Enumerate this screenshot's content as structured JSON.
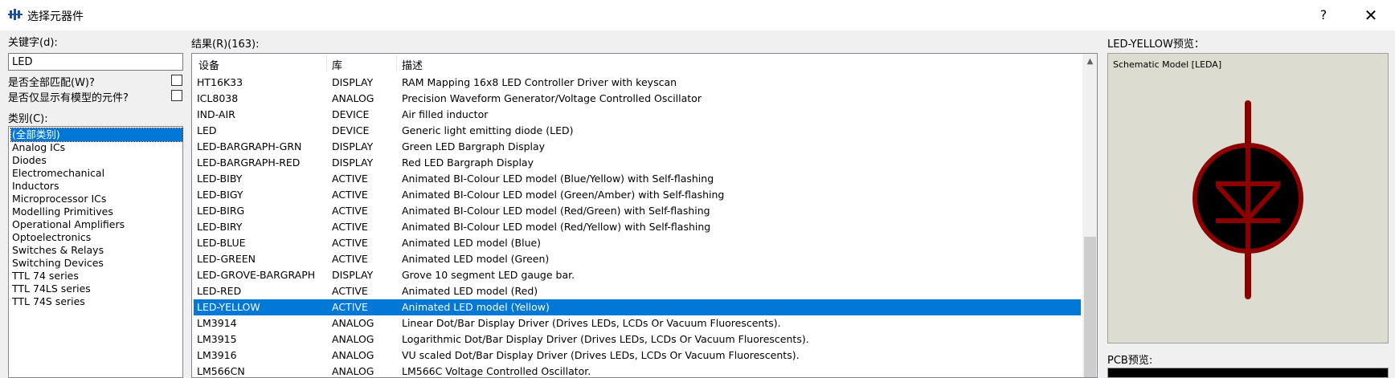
{
  "window": {
    "title": "选择元器件",
    "help": "?",
    "close": "✕"
  },
  "keyword": {
    "label": "关键字(d):",
    "value": "LED"
  },
  "options": [
    {
      "label": "是否全部匹配(W)?",
      "checked": false
    },
    {
      "label": "是否仅显示有模型的元件?",
      "checked": false
    }
  ],
  "categories": {
    "label": "类别(C):",
    "items": [
      "(全部类别)",
      "Analog ICs",
      "Diodes",
      "Electromechanical",
      "Inductors",
      "Microprocessor ICs",
      "Modelling Primitives",
      "Operational Amplifiers",
      "Optoelectronics",
      "Switches & Relays",
      "Switching Devices",
      "TTL 74 series",
      "TTL 74LS series",
      "TTL 74S series"
    ],
    "selected": 0
  },
  "results": {
    "label": "结果(R)(163):",
    "columns": [
      "设备",
      "库",
      "描述"
    ],
    "rows": [
      [
        "HT16K33",
        "DISPLAY",
        "RAM Mapping 16x8 LED Controller Driver with keyscan"
      ],
      [
        "ICL8038",
        "ANALOG",
        "Precision Waveform Generator/Voltage Controlled Oscillator"
      ],
      [
        "IND-AIR",
        "DEVICE",
        "Air filled inductor"
      ],
      [
        "LED",
        "DEVICE",
        "Generic light emitting diode (LED)"
      ],
      [
        "LED-BARGRAPH-GRN",
        "DISPLAY",
        "Green LED Bargraph Display"
      ],
      [
        "LED-BARGRAPH-RED",
        "DISPLAY",
        "Red LED Bargraph Display"
      ],
      [
        "LED-BIBY",
        "ACTIVE",
        "Animated BI-Colour LED model (Blue/Yellow) with Self-flashing"
      ],
      [
        "LED-BIGY",
        "ACTIVE",
        "Animated BI-Colour LED model (Green/Amber) with Self-flashing"
      ],
      [
        "LED-BIRG",
        "ACTIVE",
        "Animated BI-Colour LED model (Red/Green) with Self-flashing"
      ],
      [
        "LED-BIRY",
        "ACTIVE",
        "Animated BI-Colour LED model (Red/Yellow) with Self-flashing"
      ],
      [
        "LED-BLUE",
        "ACTIVE",
        "Animated LED model (Blue)"
      ],
      [
        "LED-GREEN",
        "ACTIVE",
        "Animated LED model (Green)"
      ],
      [
        "LED-GROVE-BARGRAPH",
        "DISPLAY",
        "Grove 10 segment LED gauge bar."
      ],
      [
        "LED-RED",
        "ACTIVE",
        "Animated LED model (Red)"
      ],
      [
        "LED-YELLOW",
        "ACTIVE",
        "Animated LED model (Yellow)"
      ],
      [
        "LM3914",
        "ANALOG",
        "Linear Dot/Bar Display Driver (Drives LEDs, LCDs Or Vacuum Fluorescents)."
      ],
      [
        "LM3915",
        "ANALOG",
        "Logarithmic Dot/Bar Display Driver (Drives LEDs, LCDs Or Vacuum Fluorescents)."
      ],
      [
        "LM3916",
        "ANALOG",
        "VU scaled Dot/Bar Display Driver (Drives LEDs, LCDs Or Vacuum Fluorescents)."
      ],
      [
        "LM566CN",
        "ANALOG",
        "LM566C Voltage Controlled Oscillator."
      ]
    ],
    "selected": 14,
    "scroll_position": 0.56
  },
  "preview": {
    "label": "LED-YELLOW预览：",
    "model": "Schematic Model [LEDA]"
  },
  "pcb": {
    "label": "PCB预览:"
  },
  "colors": {
    "selection": "#0078d7",
    "symbol": "#8b0000",
    "preview_bg": "#dcdcd0"
  },
  "icons": {
    "app": "component-icon",
    "scroll_up": "chevron-up-icon"
  }
}
